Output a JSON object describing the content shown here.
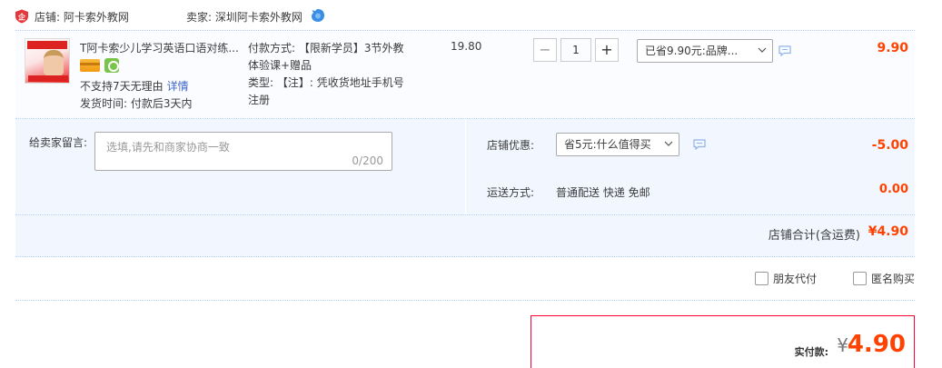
{
  "shop": {
    "label": "店铺: 阿卡索外教网",
    "seller": "卖家: 深圳阿卡索外教网"
  },
  "item": {
    "title": "T阿卡索少儿学习英语口语对练...",
    "no_return": "不支持7天无理由",
    "detail_link": "详情",
    "ship_time": "发货时间:  付款后3天内",
    "sku_lines": [
      "付款方式: 【限新学员】3节外教",
      "体验课+赠品",
      "类型: 【注】: 凭收货地址手机号",
      "注册"
    ],
    "unit_price": "19.80",
    "quantity": "1",
    "minus": "−",
    "plus": "+",
    "promo_selected": "已省9.90元:品牌...",
    "total": "9.90"
  },
  "message": {
    "label": "给卖家留言:",
    "placeholder": "选填,请先和商家协商一致",
    "counter": "0/200"
  },
  "shop_promo": {
    "label": "店铺优惠:",
    "selected": "省5元:什么值得买",
    "amount": "-5.00"
  },
  "shipping": {
    "label": "运送方式:",
    "value": "普通配送 快递 免邮",
    "amount": "0.00"
  },
  "subtotal": {
    "label": "店铺合计(含运费)",
    "value": "¥4.90"
  },
  "options": {
    "friend_pay": "朋友代付",
    "anonymous": "匿名购买"
  },
  "pay": {
    "label": "实付款:",
    "currency": "¥",
    "amount": "4.90"
  },
  "colors": {
    "accent": "#ff4200",
    "link": "#3c66c7",
    "row_bg": "#fbfcff",
    "panel_bg": "#f2f7ff",
    "pay_border": "#ff0036"
  }
}
